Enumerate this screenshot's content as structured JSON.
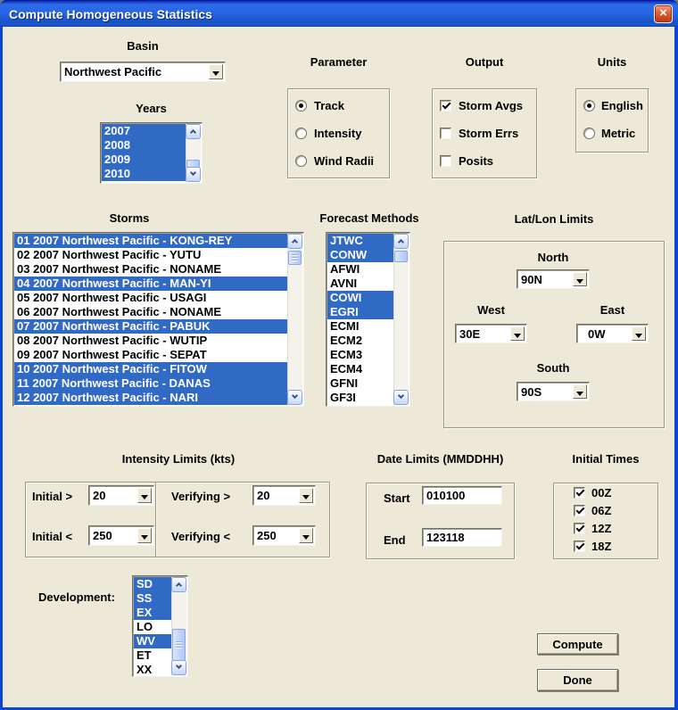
{
  "window": {
    "title": "Compute Homogeneous Statistics",
    "close_glyph": "×"
  },
  "basin": {
    "label": "Basin",
    "value": "Northwest Pacific"
  },
  "years": {
    "label": "Years",
    "items": [
      {
        "text": "2007",
        "selected": true
      },
      {
        "text": "2008",
        "selected": true
      },
      {
        "text": "2009",
        "selected": true
      },
      {
        "text": "2010",
        "selected": true
      }
    ]
  },
  "parameter": {
    "label": "Parameter",
    "options": [
      {
        "label": "Track",
        "selected": true
      },
      {
        "label": "Intensity",
        "selected": false
      },
      {
        "label": "Wind Radii",
        "selected": false
      }
    ]
  },
  "output": {
    "label": "Output",
    "options": [
      {
        "label": "Storm Avgs",
        "checked": true
      },
      {
        "label": "Storm Errs",
        "checked": false
      },
      {
        "label": "Posits",
        "checked": false
      }
    ]
  },
  "units": {
    "label": "Units",
    "options": [
      {
        "label": "English",
        "selected": true
      },
      {
        "label": "Metric",
        "selected": false
      }
    ]
  },
  "storms": {
    "label": "Storms",
    "items": [
      {
        "text": "01 2007 Northwest Pacific - KONG-REY",
        "selected": true
      },
      {
        "text": "02 2007 Northwest Pacific - YUTU",
        "selected": false
      },
      {
        "text": "03 2007 Northwest Pacific - NONAME",
        "selected": false
      },
      {
        "text": "04 2007 Northwest Pacific - MAN-YI",
        "selected": true
      },
      {
        "text": "05 2007 Northwest Pacific - USAGI",
        "selected": false
      },
      {
        "text": "06 2007 Northwest Pacific - NONAME",
        "selected": false
      },
      {
        "text": "07 2007 Northwest Pacific - PABUK",
        "selected": true
      },
      {
        "text": "08 2007 Northwest Pacific - WUTIP",
        "selected": false
      },
      {
        "text": "09 2007 Northwest Pacific - SEPAT",
        "selected": false
      },
      {
        "text": "10 2007 Northwest Pacific - FITOW",
        "selected": true
      },
      {
        "text": "11 2007 Northwest Pacific - DANAS",
        "selected": true
      },
      {
        "text": "12 2007 Northwest Pacific - NARI",
        "selected": true
      }
    ]
  },
  "forecast_methods": {
    "label": "Forecast Methods",
    "items": [
      {
        "text": "JTWC",
        "selected": true
      },
      {
        "text": "CONW",
        "selected": true
      },
      {
        "text": "AFWI",
        "selected": false
      },
      {
        "text": "AVNI",
        "selected": false
      },
      {
        "text": "COWI",
        "selected": true
      },
      {
        "text": "EGRI",
        "selected": true
      },
      {
        "text": "ECMI",
        "selected": false
      },
      {
        "text": "ECM2",
        "selected": false
      },
      {
        "text": "ECM3",
        "selected": false
      },
      {
        "text": "ECM4",
        "selected": false
      },
      {
        "text": "GFNI",
        "selected": false
      },
      {
        "text": "GF3I",
        "selected": false
      }
    ]
  },
  "latlon": {
    "label": "Lat/Lon Limits",
    "north_label": "North",
    "north": "90N",
    "west_label": "West",
    "west": "30E",
    "east_label": "East",
    "east": "0W",
    "south_label": "South",
    "south": "90S"
  },
  "intensity_limits": {
    "label": "Intensity Limits (kts)",
    "initial_gt_label": "Initial >",
    "initial_gt": "20",
    "verifying_gt_label": "Verifying >",
    "verifying_gt": "20",
    "initial_lt_label": "Initial <",
    "initial_lt": "250",
    "verifying_lt_label": "Verifying <",
    "verifying_lt": "250"
  },
  "date_limits": {
    "label": "Date Limits (MMDDHH)",
    "start_label": "Start",
    "start": "010100",
    "end_label": "End",
    "end": "123118"
  },
  "initial_times": {
    "label": "Initial Times",
    "options": [
      {
        "label": "00Z",
        "checked": true
      },
      {
        "label": "06Z",
        "checked": true
      },
      {
        "label": "12Z",
        "checked": true
      },
      {
        "label": "18Z",
        "checked": true
      }
    ]
  },
  "development": {
    "label": "Development:",
    "items": [
      {
        "text": "SD",
        "selected": true
      },
      {
        "text": "SS",
        "selected": true
      },
      {
        "text": "EX",
        "selected": true
      },
      {
        "text": "LO",
        "selected": false
      },
      {
        "text": "WV",
        "selected": true
      },
      {
        "text": "ET",
        "selected": false
      },
      {
        "text": "XX",
        "selected": false
      }
    ]
  },
  "buttons": {
    "compute": "Compute",
    "done": "Done"
  },
  "colors": {
    "selection": "#316AC5",
    "dialog_bg": "#ECE9D8",
    "titlebar_blue": "#1C57CC"
  }
}
